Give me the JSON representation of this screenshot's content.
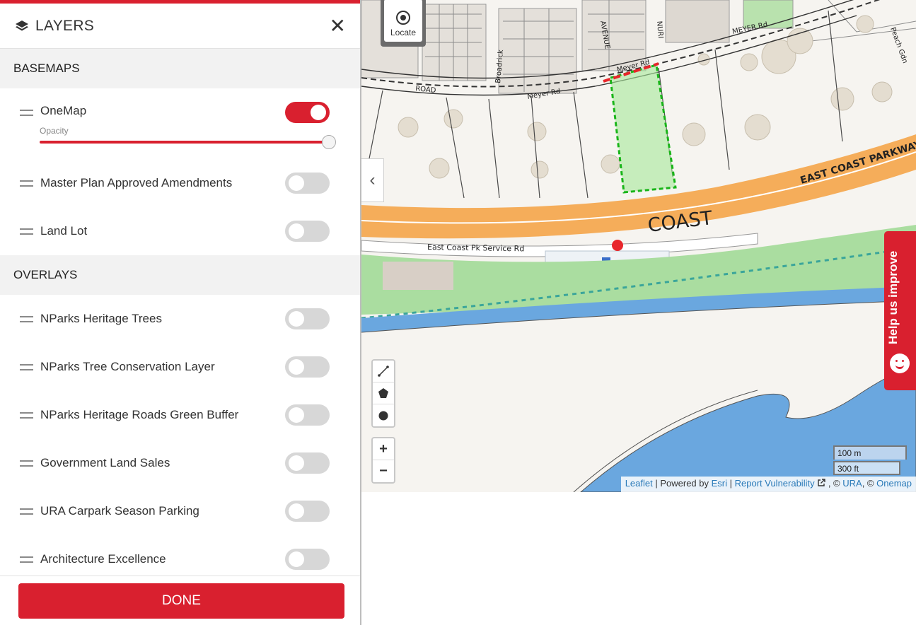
{
  "panel": {
    "title": "LAYERS",
    "close_symbol": "✕",
    "close_icon": "close-icon",
    "layers_icon": "layers-stack-icon",
    "sections": {
      "basemaps": {
        "title": "BASEMAPS",
        "items": [
          {
            "label": "OneMap",
            "on": true,
            "opacity_label": "Opacity",
            "opacity": 1.0
          },
          {
            "label": "Master Plan Approved Amendments",
            "on": false
          },
          {
            "label": "Land Lot",
            "on": false
          }
        ]
      },
      "overlays": {
        "title": "OVERLAYS",
        "items": [
          {
            "label": "NParks Heritage Trees",
            "on": false
          },
          {
            "label": "NParks Tree Conservation Layer",
            "on": false
          },
          {
            "label": "NParks Heritage Roads Green Buffer",
            "on": false
          },
          {
            "label": "Government Land Sales",
            "on": false
          },
          {
            "label": "URA Carpark Season Parking",
            "on": false
          },
          {
            "label": "Architecture Excellence",
            "on": false
          }
        ]
      }
    },
    "done_label": "DONE"
  },
  "map": {
    "collapse_symbol": "‹",
    "locate_label": "Locate",
    "zoom_in": "+",
    "zoom_out": "−",
    "draw_tools": [
      "line-draw-icon",
      "polygon-draw-icon",
      "circle-draw-icon"
    ],
    "scale": {
      "metric": "100 m",
      "imperial": "300 ft"
    },
    "road_labels": {
      "meyer_rd_1": "Meyer Rd",
      "meyer_rd_2": "Meyer Rd",
      "meyer_rd_3": "MEYER Rd",
      "road": "ROAD",
      "avenue": "AVENUE",
      "nuri": "NURI",
      "broadrick": "Broadrick",
      "ecp": "EAST COAST PARKWAY",
      "coast": "COAST",
      "service_rd": "East Coast Pk Service Rd",
      "peach": "Peach Gdn"
    },
    "attribution": {
      "leaflet": "Leaflet",
      "sep1": " | Powered by ",
      "esri": "Esri",
      "sep2": " | ",
      "report": "Report Vulnerability",
      "sep3": " , © ",
      "ura": "URA",
      "sep4": ", © ",
      "onemap": "Onemap"
    }
  },
  "help": {
    "label": "Help us improve"
  },
  "colors": {
    "accent": "#d9202f",
    "expressway": "#f5ad5a",
    "park": "#aadda0",
    "sea": "#6aa7df",
    "selection": "#22c022"
  }
}
